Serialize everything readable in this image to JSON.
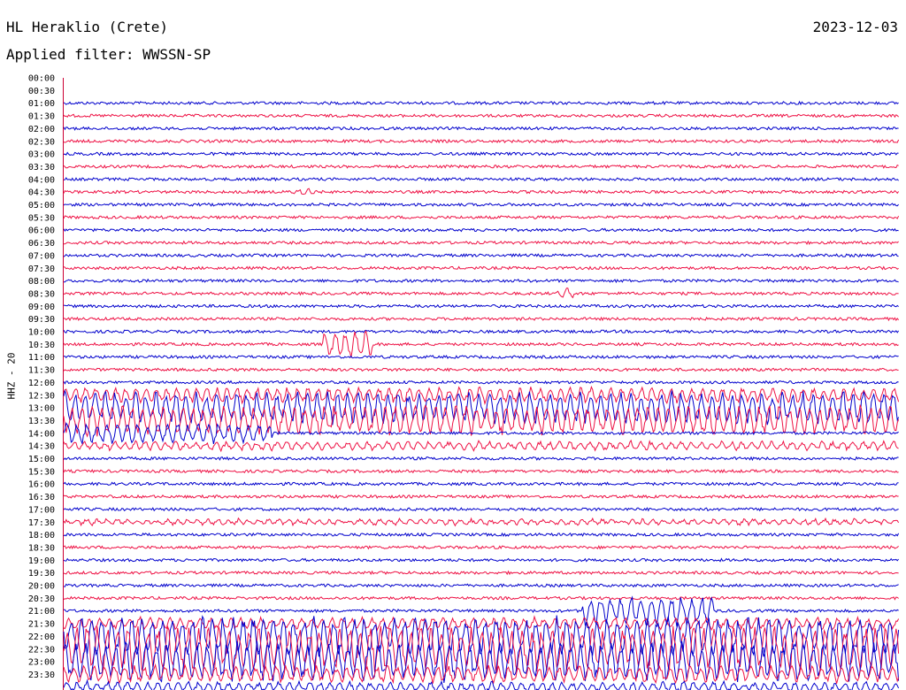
{
  "header": {
    "station": "HL Heraklio (Crete)",
    "date": "2023-12-03",
    "filter": "Applied filter: WWSSN-SP"
  },
  "colors": {
    "trace_a": "#0000cc",
    "trace_b": "#ee1144",
    "axis": "#cc0033"
  },
  "chart_data": {
    "type": "line",
    "title": "HL Heraklio (Crete)",
    "subtitle": "Applied filter: WWSSN-SP",
    "ylabel": "HHZ - 20",
    "xlabel": "",
    "grid": false,
    "legend": "none",
    "row_labels": [
      "00:00",
      "00:30",
      "01:00",
      "01:30",
      "02:00",
      "02:30",
      "03:00",
      "03:30",
      "04:00",
      "04:30",
      "05:00",
      "05:30",
      "06:00",
      "06:30",
      "07:00",
      "07:30",
      "08:00",
      "08:30",
      "09:00",
      "09:30",
      "10:00",
      "10:30",
      "11:00",
      "11:30",
      "12:00",
      "12:30",
      "13:00",
      "13:30",
      "14:00",
      "14:30",
      "15:00",
      "15:30",
      "16:00",
      "16:30",
      "17:00",
      "17:30",
      "18:00",
      "18:30",
      "19:00",
      "19:30",
      "20:00",
      "20:30",
      "21:00",
      "21:30",
      "22:00",
      "22:30",
      "23:00",
      "23:30"
    ],
    "trace_colors": [
      "#0000cc",
      "#ee1144"
    ],
    "events": [
      {
        "row": "09:30",
        "start_frac": 0.31,
        "end_frac": 0.37,
        "level": 0.8
      },
      {
        "row": "07:30",
        "start_frac": 0.59,
        "end_frac": 0.61,
        "level": 0.3
      },
      {
        "row": "03:30",
        "start_frac": 0.27,
        "end_frac": 0.3,
        "level": 0.2
      },
      {
        "row": "11:30",
        "start_frac": 0.0,
        "end_frac": 1.0,
        "level": 0.45
      },
      {
        "row": "12:00",
        "start_frac": 0.0,
        "end_frac": 1.0,
        "level": 1.0
      },
      {
        "row": "12:30",
        "start_frac": 0.0,
        "end_frac": 1.0,
        "level": 0.9
      },
      {
        "row": "13:00",
        "start_frac": 0.0,
        "end_frac": 0.25,
        "level": 0.6
      },
      {
        "row": "13:30",
        "start_frac": 0.0,
        "end_frac": 1.0,
        "level": 0.25
      },
      {
        "row": "16:30",
        "start_frac": 0.0,
        "end_frac": 1.0,
        "level": 0.15
      },
      {
        "row": "20:00",
        "start_frac": 0.62,
        "end_frac": 0.78,
        "level": 0.9
      },
      {
        "row": "20:30",
        "start_frac": 0.0,
        "end_frac": 1.0,
        "level": 0.35
      },
      {
        "row": "21:00",
        "start_frac": 0.0,
        "end_frac": 1.0,
        "level": 1.2
      },
      {
        "row": "21:30",
        "start_frac": 0.0,
        "end_frac": 1.0,
        "level": 1.4
      },
      {
        "row": "22:00",
        "start_frac": 0.0,
        "end_frac": 1.0,
        "level": 1.2
      },
      {
        "row": "22:30",
        "start_frac": 0.0,
        "end_frac": 1.0,
        "level": 0.5
      },
      {
        "row": "23:00",
        "start_frac": 0.0,
        "end_frac": 1.0,
        "level": 0.3
      }
    ]
  }
}
